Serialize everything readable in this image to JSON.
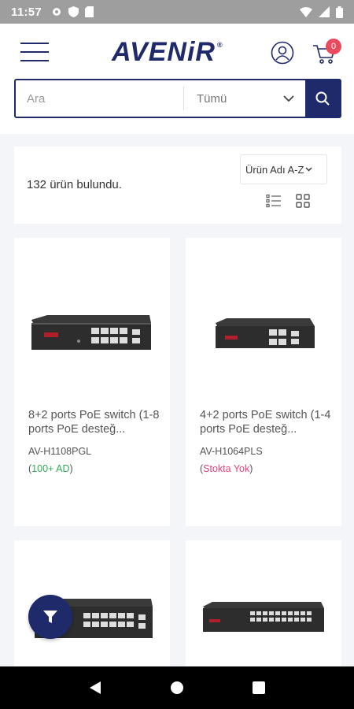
{
  "status_bar": {
    "time": "11:57"
  },
  "header": {
    "logo_text": "AVENiR",
    "cart_count": "0"
  },
  "search": {
    "placeholder": "Ara",
    "category": "Tümü"
  },
  "results": {
    "count_text": "132 ürün bulundu.",
    "sort_label": "Ürün Adı A-Z"
  },
  "products": [
    {
      "title": "8+2 ports PoE switch (1-8 ports PoE desteğ...",
      "sku": "AV-H1108PGL",
      "stock": "100+ AD",
      "stock_status": "in-stock"
    },
    {
      "title": "4+2 ports PoE switch (1-4 ports PoE desteğ...",
      "sku": "AV-H1064PLS",
      "stock": "Stokta Yok",
      "stock_status": "out-of-stock"
    },
    {
      "title": "",
      "sku": "",
      "stock": "",
      "stock_status": ""
    },
    {
      "title": "",
      "sku": "",
      "stock": "",
      "stock_status": ""
    }
  ],
  "colors": {
    "brand": "#1f2a6b",
    "badge": "#e94b5c",
    "in_stock": "#2fae5a",
    "out_of_stock": "#e8457a"
  },
  "icons": [
    "hamburger-menu-icon",
    "user-icon",
    "cart-icon",
    "search-icon",
    "chevron-down-icon",
    "list-view-icon",
    "grid-view-icon",
    "filter-icon"
  ]
}
